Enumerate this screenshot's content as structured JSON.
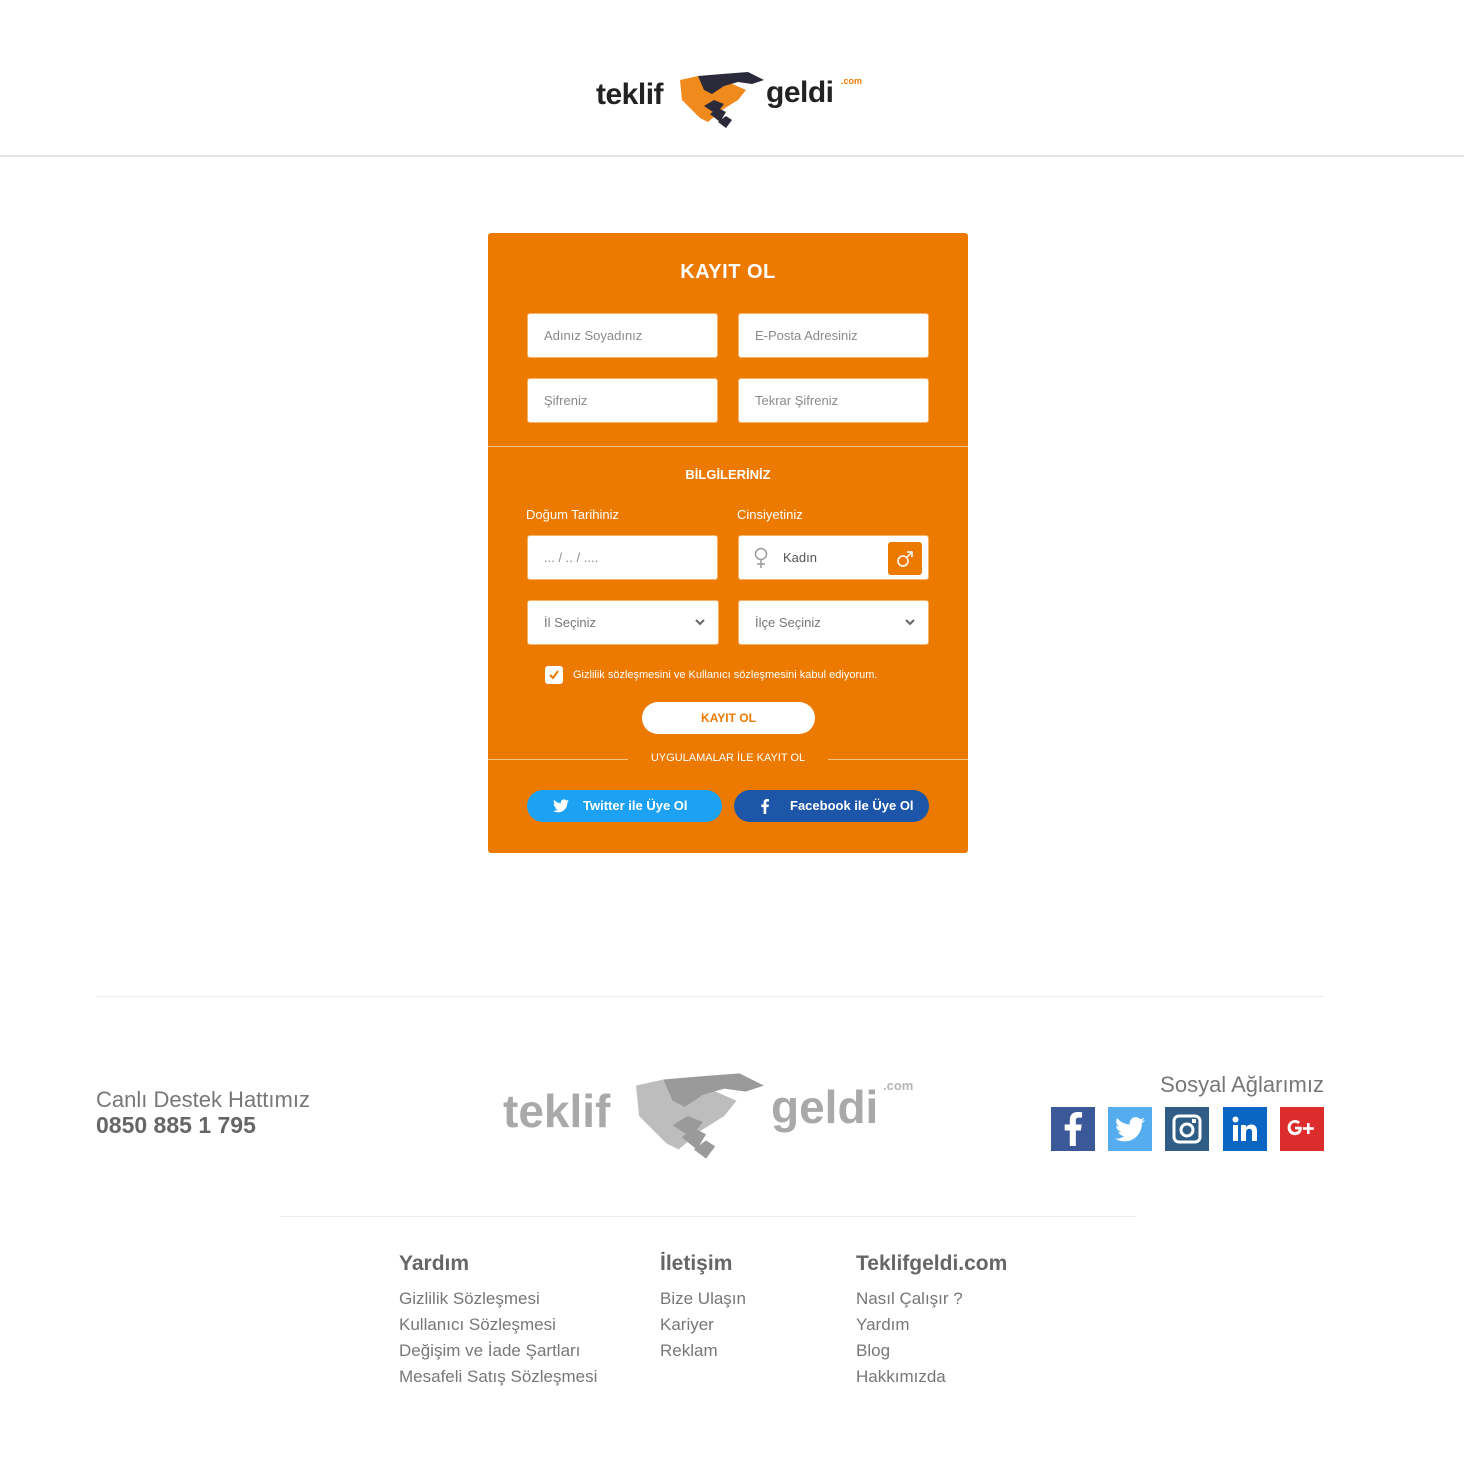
{
  "header": {
    "logo": {
      "part1": "teklif",
      "part2": "geldi",
      "suffix": ".com"
    }
  },
  "form": {
    "title": "KAYIT OL",
    "fields": {
      "name_placeholder": "Adınız Soyadınız",
      "email_placeholder": "E-Posta Adresiniz",
      "password_placeholder": "Şifreniz",
      "password_repeat_placeholder": "Tekrar Şifreniz"
    },
    "section_title": "BİLGİLERİNİZ",
    "birthdate_label": "Doğum Tarihiniz",
    "birthdate_placeholder": "... / .. / ....",
    "gender_label": "Cinsiyetiniz",
    "gender_value": "Kadın",
    "city_select": "İl Seçiniz",
    "district_select": "İlçe Seçiniz",
    "agreement_text": "Gizlilik sözleşmesini ve Kullanıcı sözleşmesini kabul ediyorum.",
    "agreement_checked": true,
    "submit_label": "KAYIT OL",
    "social_divider": "UYGULAMALAR İLE KAYIT OL",
    "twitter_label": "Twitter ile Üye Ol",
    "facebook_label": "Facebook ile Üye Ol",
    "colors": {
      "accent": "#ec7a00",
      "twitter": "#1da1f2",
      "facebook": "#1d56a8"
    }
  },
  "footer": {
    "support_label": "Canlı Destek Hattımız",
    "support_phone": "0850 885 1 795",
    "logo": {
      "part1": "teklif",
      "part2": "geldi",
      "suffix": ".com"
    },
    "social_title": "Sosyal Ağlarımız",
    "social_icons": [
      {
        "name": "facebook-icon",
        "color": "#3b5998"
      },
      {
        "name": "twitter-icon",
        "color": "#55acee"
      },
      {
        "name": "instagram-icon",
        "color": "#2f5d86"
      },
      {
        "name": "linkedin-icon",
        "color": "#0a66c2"
      },
      {
        "name": "google-plus-icon",
        "color": "#dd2c2c"
      }
    ],
    "columns": [
      {
        "title": "Yardım",
        "links": [
          "Gizlilik Sözleşmesi",
          "Kullanıcı Sözleşmesi",
          "Değişim ve İade Şartları",
          "Mesafeli Satış Sözleşmesi"
        ]
      },
      {
        "title": "İletişim",
        "links": [
          "Bize Ulaşın",
          "Kariyer",
          "Reklam"
        ]
      },
      {
        "title": "Teklifgeldi.com",
        "links": [
          "Nasıl Çalışır ?",
          "Yardım",
          "Blog",
          "Hakkımızda"
        ]
      }
    ]
  }
}
